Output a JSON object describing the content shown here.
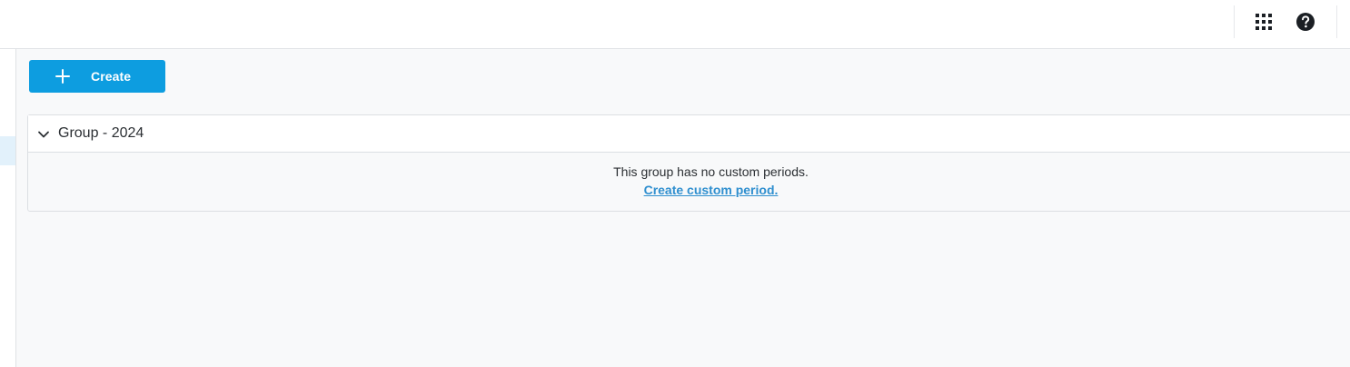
{
  "topbar": {
    "apps_icon": "apps-grid-icon",
    "help_icon": "help-circle-icon"
  },
  "toolbar": {
    "create_label": "Create",
    "create_icon": "plus-icon"
  },
  "group": {
    "title": "Group - 2024",
    "expanded": true,
    "empty_message": "This group has no custom periods.",
    "empty_link": "Create custom period."
  },
  "colors": {
    "accent": "#0d9de0",
    "link": "#2f8fcf",
    "background": "#f8f9fa",
    "text": "#2b2f33"
  }
}
